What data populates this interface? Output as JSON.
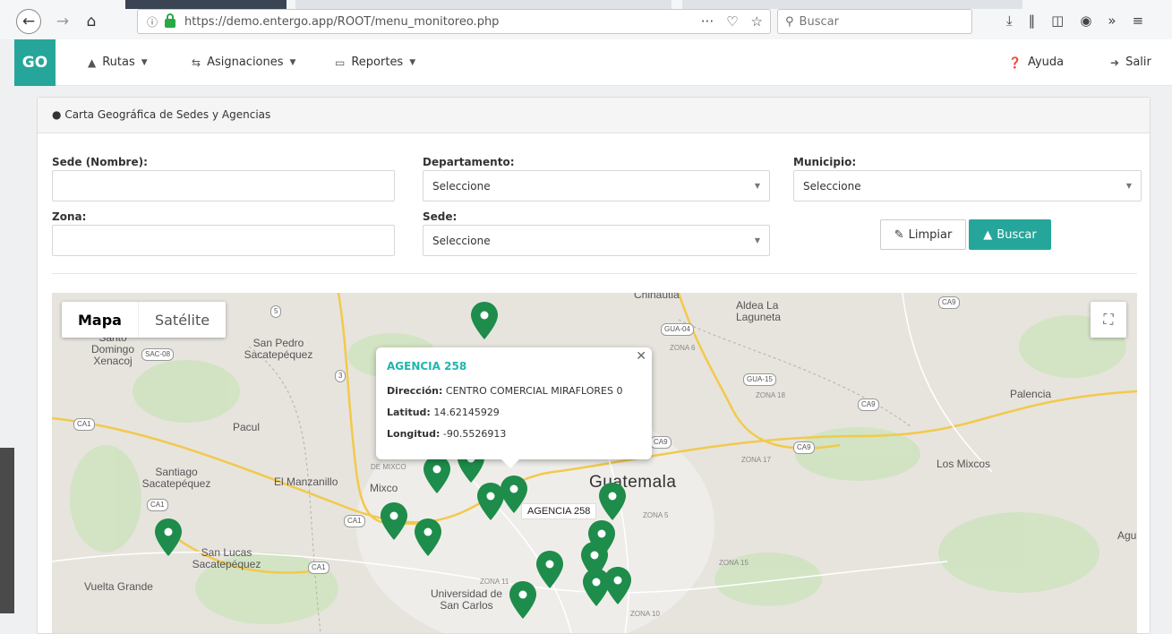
{
  "browser": {
    "url_host": "https://demo.entergo.app",
    "url_path": "/ROOT/menu_monitoreo.php",
    "search_placeholder": "Buscar",
    "more_icon": "···"
  },
  "app": {
    "logo": "GO",
    "nav": [
      {
        "label": "Rutas"
      },
      {
        "label": "Asignaciones"
      },
      {
        "label": "Reportes"
      }
    ],
    "help": "Ayuda",
    "logout": "Salir"
  },
  "panel": {
    "title": "Carta Geográfica de Sedes y Agencias",
    "sede_nombre_label": "Sede (Nombre):",
    "departamento_label": "Departamento:",
    "departamento_value": "Seleccione",
    "municipio_label": "Municipio:",
    "municipio_value": "Seleccione",
    "zona_label": "Zona:",
    "sede_label": "Sede:",
    "sede_value": "Seleccione",
    "limpiar": "Limpiar",
    "buscar": "Buscar"
  },
  "map": {
    "mapa": "Mapa",
    "satelite": "Satélite",
    "places": {
      "chinautla": "Chinautla",
      "aldea": "Aldea La Laguneta",
      "palencia": "Palencia",
      "los_mixcos": "Los Mixcos",
      "guatemala": "Guatemala",
      "mixco": "Mixco",
      "el_manzanillo": "El Manzanillo",
      "pacul": "Pacul",
      "san_pedro": "San Pedro Sacatepéquez",
      "santo_domingo": "Santo Domingo Xenacoj",
      "santiago": "Santiago Sacatepéquez",
      "san_lucas": "San Lucas Sacatepéquez",
      "vuelta_grande": "Vuelta Grande",
      "universidad": "Universidad de San Carlos",
      "agu": "Agu",
      "zona6": "ZONA 6",
      "zona18": "ZONA 18",
      "zona17": "ZONA 17",
      "zona5": "ZONA 5",
      "zona15": "ZONA 15",
      "zona11": "ZONA 11",
      "zona10": "ZONA 10",
      "de_mixco": "DE MIXCO"
    },
    "shields": {
      "s5": "5",
      "sac08": "SAC-08",
      "ca1a": "CA1",
      "ca1b": "CA1",
      "ca1c": "CA1",
      "ca1d": "CA1",
      "gua04": "GUA-04",
      "gua15": "GUA-15",
      "ca9a": "CA9",
      "ca9b": "CA9",
      "ca9c": "CA9",
      "ca9d": "CA9",
      "s3": "3"
    },
    "popup": {
      "title": "AGENCIA 258",
      "direccion_label": "Dirección:",
      "direccion_value": "CENTRO COMERCIAL MIRAFLORES 0",
      "latitud_label": "Latitud:",
      "latitud_value": "14.62145929",
      "longitud_label": "Longitud:",
      "longitud_value": "-90.5526913"
    },
    "marker_label": "AGENCIA 258"
  }
}
